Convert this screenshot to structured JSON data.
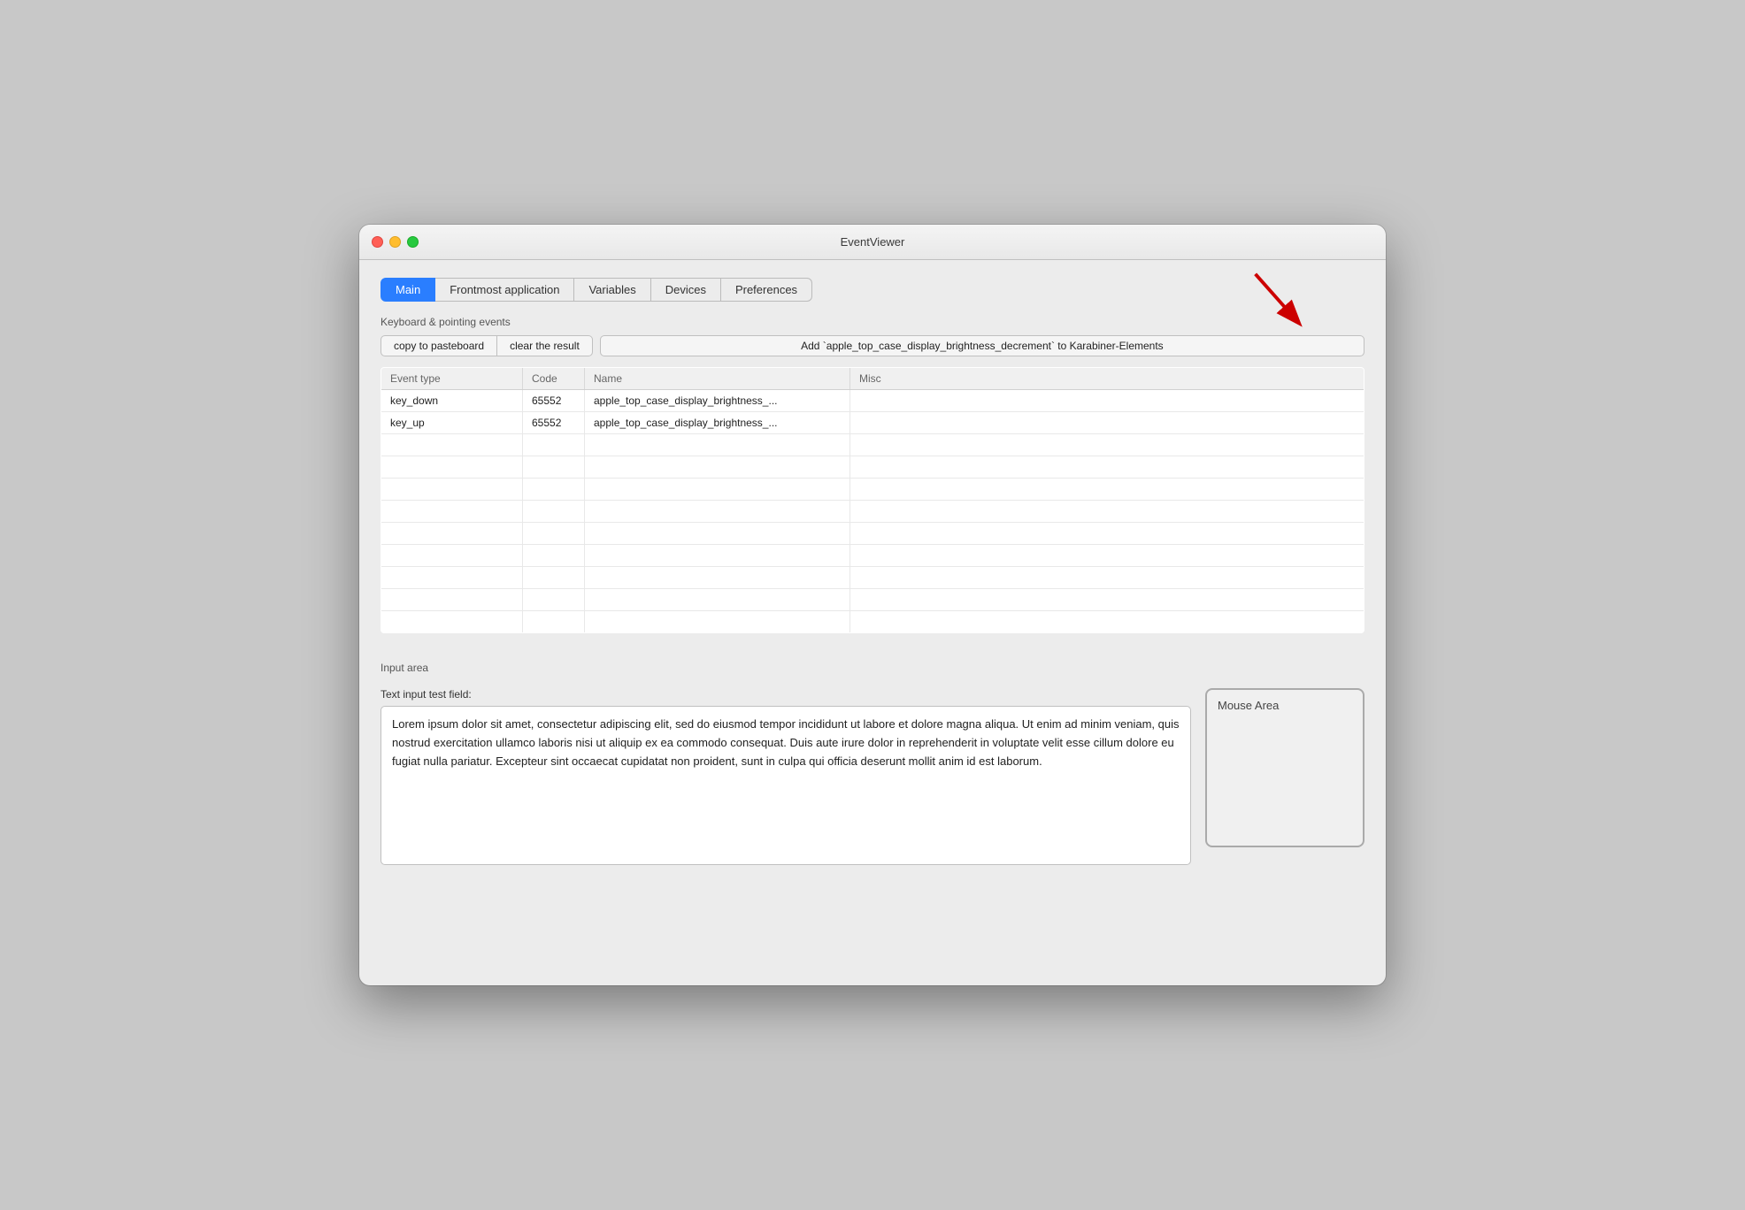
{
  "window": {
    "title": "EventViewer"
  },
  "tabs": [
    {
      "id": "main",
      "label": "Main",
      "active": true
    },
    {
      "id": "frontmost",
      "label": "Frontmost application",
      "active": false
    },
    {
      "id": "variables",
      "label": "Variables",
      "active": false
    },
    {
      "id": "devices",
      "label": "Devices",
      "active": false
    },
    {
      "id": "preferences",
      "label": "Preferences",
      "active": false
    }
  ],
  "keyboard_section": {
    "label": "Keyboard & pointing events",
    "copy_btn": "copy to pasteboard",
    "clear_btn": "clear the result",
    "add_btn": "Add `apple_top_case_display_brightness_decrement` to Karabiner-Elements"
  },
  "table": {
    "columns": [
      "Event type",
      "Code",
      "Name",
      "Misc"
    ],
    "rows": [
      {
        "event_type": "key_down",
        "code": "65552",
        "name": "apple_top_case_display_brightness_...",
        "misc": ""
      },
      {
        "event_type": "key_up",
        "code": "65552",
        "name": "apple_top_case_display_brightness_...",
        "misc": ""
      }
    ],
    "empty_row_count": 9
  },
  "input_area": {
    "section_label": "Input area",
    "text_field_label": "Text input test field:",
    "text_content": "Lorem ipsum dolor sit amet, consectetur adipiscing elit, sed do eiusmod tempor incididunt ut labore et dolore magna aliqua. Ut enim ad minim veniam, quis nostrud exercitation ullamco laboris nisi ut aliquip ex ea commodo consequat. Duis aute irure dolor in reprehenderit in voluptate velit esse cillum dolore eu fugiat nulla pariatur. Excepteur sint occaecat cupidatat non proident, sunt in culpa qui officia deserunt mollit anim id est laborum.",
    "mouse_area_label": "Mouse Area"
  }
}
